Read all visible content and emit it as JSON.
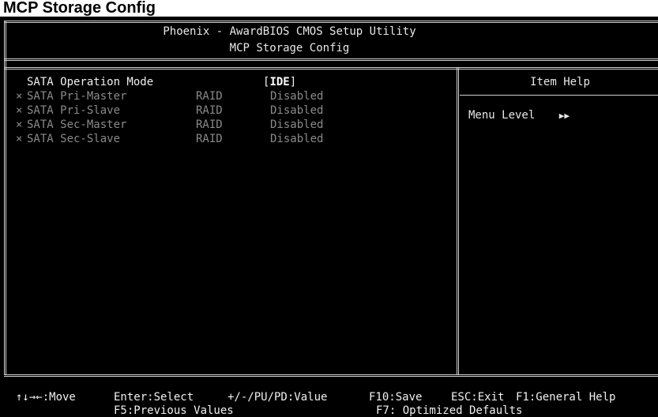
{
  "page": {
    "heading": "MCP Storage Config"
  },
  "bios": {
    "title": "Phoenix - AwardBIOS CMOS Setup Utility",
    "subtitle": "MCP Storage Config"
  },
  "settings": [
    {
      "marker": "",
      "label": "SATA Operation Mode",
      "raid": "",
      "value": "[IDE]",
      "selected_value": "IDE",
      "disabled": false
    },
    {
      "marker": "×",
      "label": "SATA Pri-Master",
      "raid": "RAID",
      "value": "Disabled",
      "disabled": true
    },
    {
      "marker": "×",
      "label": "SATA Pri-Slave",
      "raid": "RAID",
      "value": "Disabled",
      "disabled": true
    },
    {
      "marker": "×",
      "label": "SATA Sec-Master",
      "raid": "RAID",
      "value": "Disabled",
      "disabled": true
    },
    {
      "marker": "×",
      "label": "SATA Sec-Slave",
      "raid": "RAID",
      "value": "Disabled",
      "disabled": true
    }
  ],
  "help": {
    "title": "Item Help",
    "menu_level_label": "Menu Level",
    "menu_level_arrows": "▶▶"
  },
  "footer": {
    "line1": [
      "↑↓→←:Move",
      "Enter:Select",
      "+/-/PU/PD:Value",
      "F10:Save",
      "ESC:Exit",
      "F1:General Help"
    ],
    "line2": [
      "F5:Previous Values",
      "F7: Optimized Defaults"
    ]
  },
  "colors": {
    "background": "#000000",
    "text": "#d4d4d4",
    "disabled_text": "#8a8a8a"
  }
}
